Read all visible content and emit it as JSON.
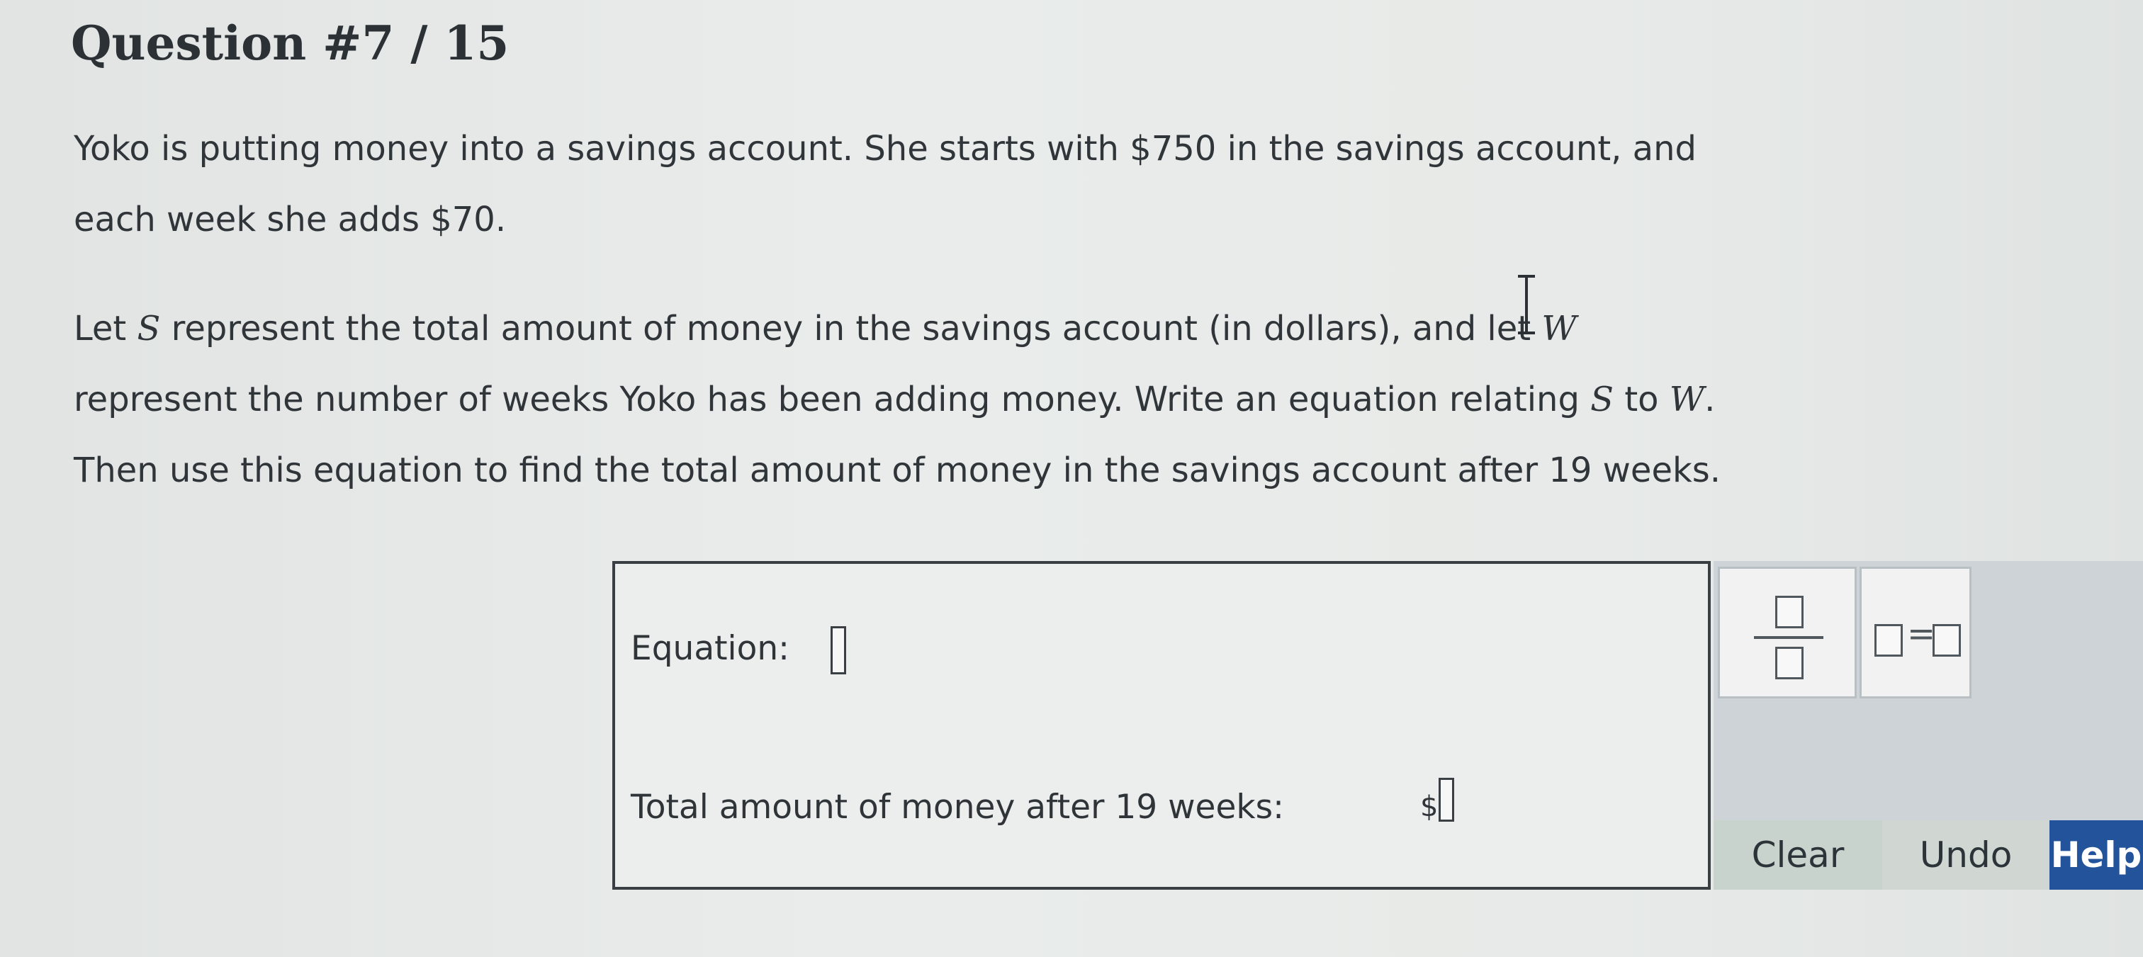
{
  "question": {
    "title": "Question #7 / 15"
  },
  "problem": {
    "line1": "Yoko is putting money into a savings account. She starts with $750 in the savings account, and",
    "line2": "each week she adds $70.",
    "line3_a": "Let ",
    "line3_s": "S",
    "line3_b": " represent the total amount of money in the savings account (in dollars), and let ",
    "line3_w": "W",
    "line4_a": "represent the number of weeks Yoko has been adding money. Write an equation relating ",
    "line4_s": "S",
    "line4_b": " to ",
    "line4_w": "W",
    "line4_c": ".",
    "line5": "Then use this equation to find the total amount of money in the savings account after 19 weeks."
  },
  "answer": {
    "equation_label": "Equation:",
    "equation_value": "",
    "total_label": "Total amount of money after 19 weeks:",
    "currency_symbol": "$",
    "total_value": ""
  },
  "tools": {
    "fraction_icon": "fraction-template-icon",
    "equation_icon": "equation-template-icon",
    "equals_sign": "="
  },
  "actions": {
    "clear": "Clear",
    "undo": "Undo",
    "help": "Help"
  },
  "colors": {
    "help_button": "#23539a",
    "panel": "#cdd3d6"
  }
}
